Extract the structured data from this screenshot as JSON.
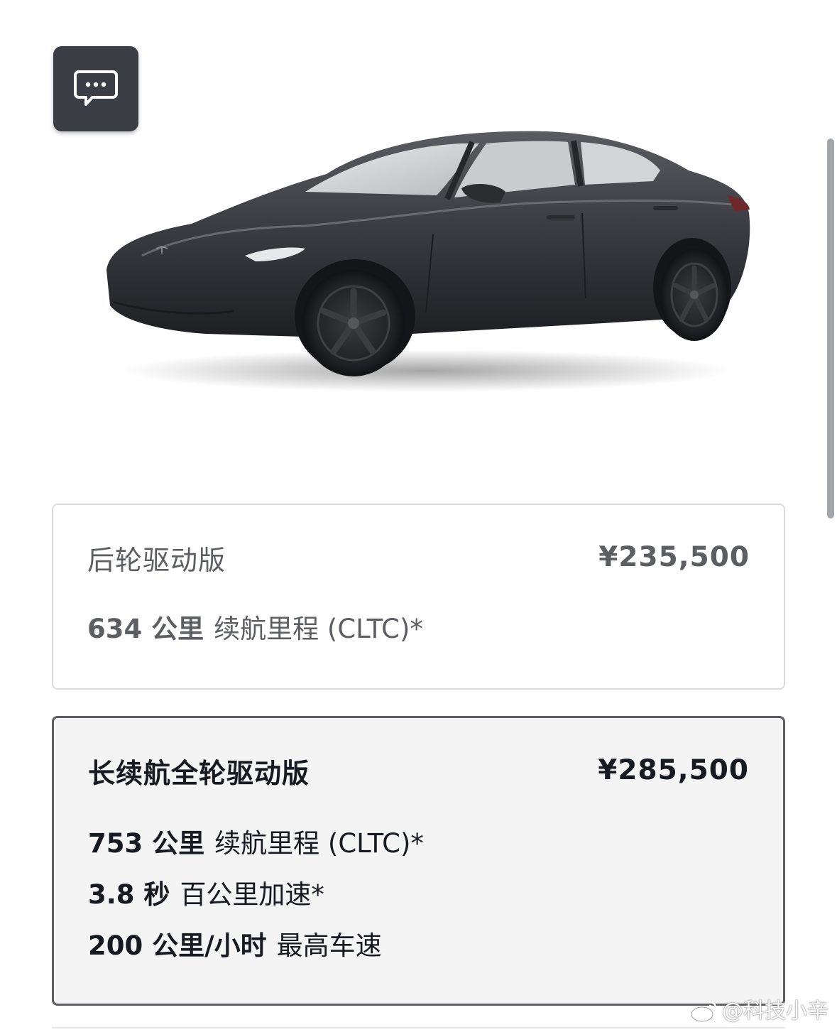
{
  "trims": [
    {
      "name": "后轮驱动版",
      "price": "¥235,500",
      "specs": [
        {
          "value": "634 公里",
          "label": "续航里程 (CLTC)*"
        }
      ]
    },
    {
      "name": "长续航全轮驱动版",
      "price": "¥285,500",
      "specs": [
        {
          "value": "753 公里",
          "label": "续航里程 (CLTC)*"
        },
        {
          "value": "3.8 秒",
          "label": "百公里加速*"
        },
        {
          "value": "200 公里/小时",
          "label": "最高车速"
        }
      ]
    }
  ],
  "watermark": {
    "text": "@科技小辛",
    "icon": "weibo-icon"
  },
  "icons": {
    "chat": "chat-bubble-icon"
  },
  "colors": {
    "chat_button_bg": "#3b3e44",
    "selected_border": "#5c5e62",
    "selected_bg": "#f4f4f4",
    "car_paint": "#3a3b40"
  }
}
